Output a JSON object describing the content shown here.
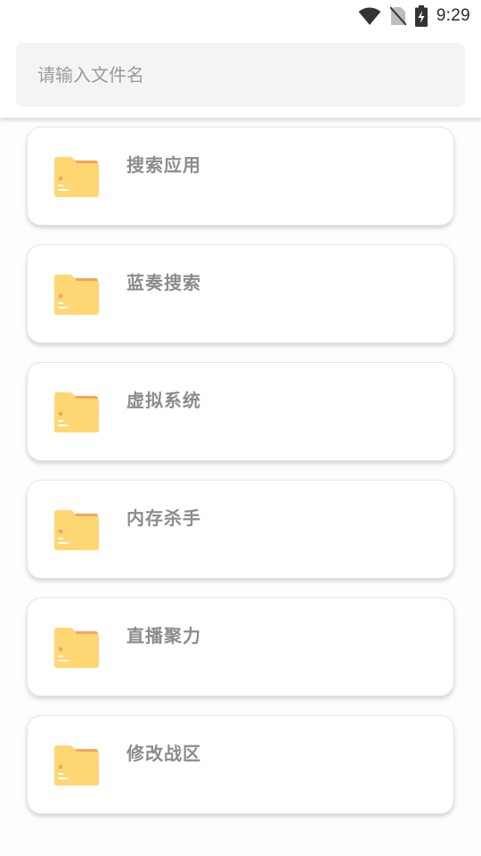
{
  "status_bar": {
    "time": "9:29",
    "icons": [
      "wifi-icon",
      "no-sim-icon",
      "battery-charging-icon"
    ]
  },
  "search": {
    "placeholder": "请输入文件名",
    "value": ""
  },
  "colors": {
    "folder_body": "#ffd772",
    "folder_tab": "#f7a35c",
    "label_text": "#8c8c8c"
  },
  "items": [
    {
      "label": "搜索应用",
      "icon": "folder-icon"
    },
    {
      "label": "蓝奏搜索",
      "icon": "folder-icon"
    },
    {
      "label": "虚拟系统",
      "icon": "folder-icon"
    },
    {
      "label": "内存杀手",
      "icon": "folder-icon"
    },
    {
      "label": "直播聚力",
      "icon": "folder-icon"
    },
    {
      "label": "修改战区",
      "icon": "folder-icon"
    }
  ]
}
